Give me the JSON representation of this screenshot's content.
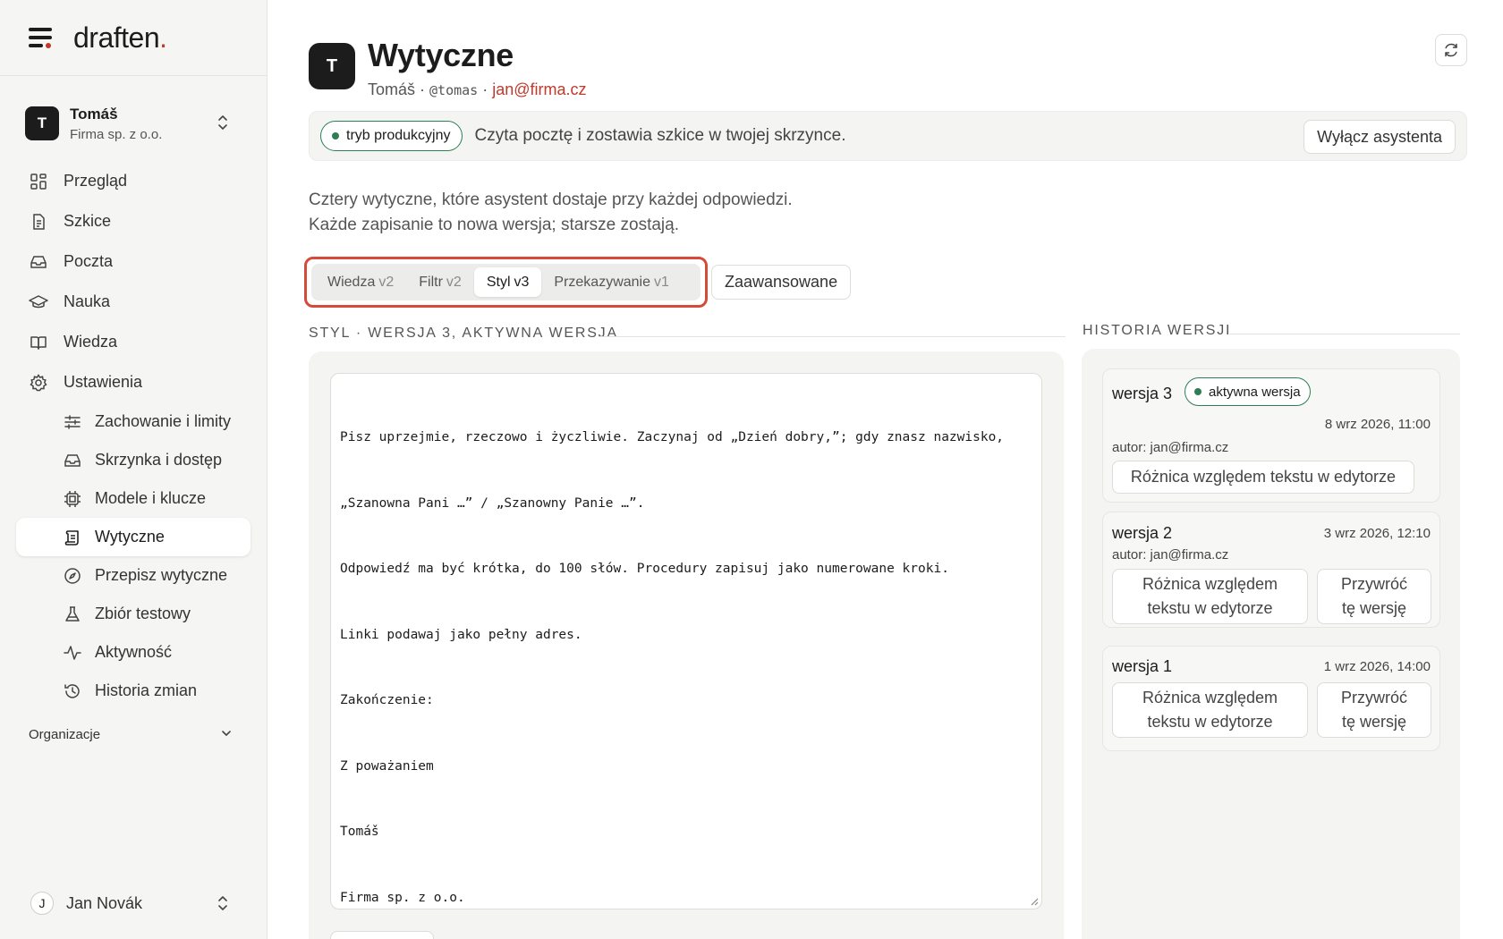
{
  "app": {
    "logo": "draften",
    "logo_dot": "."
  },
  "account": {
    "initial": "T",
    "name": "Tomáš",
    "org": "Firma sp. z o.o."
  },
  "nav": {
    "items": [
      {
        "label": "Przegląd",
        "icon": "grid-icon"
      },
      {
        "label": "Szkice",
        "icon": "document-icon"
      },
      {
        "label": "Poczta",
        "icon": "inbox-icon"
      },
      {
        "label": "Nauka",
        "icon": "graduation-cap-icon"
      },
      {
        "label": "Wiedza",
        "icon": "book-icon"
      },
      {
        "label": "Ustawienia",
        "icon": "gear-icon"
      }
    ],
    "sub_items": [
      {
        "label": "Zachowanie i limity",
        "icon": "sliders-icon"
      },
      {
        "label": "Skrzynka i dostęp",
        "icon": "inbox-icon"
      },
      {
        "label": "Modele i klucze",
        "icon": "chip-icon"
      },
      {
        "label": "Wytyczne",
        "icon": "scroll-icon",
        "active": true
      },
      {
        "label": "Przepisz wytyczne",
        "icon": "compass-icon"
      },
      {
        "label": "Zbiór testowy",
        "icon": "flask-icon"
      },
      {
        "label": "Aktywność",
        "icon": "activity-icon"
      },
      {
        "label": "Historia zmian",
        "icon": "history-icon"
      }
    ],
    "org_section": "Organizacje"
  },
  "user": {
    "initial": "J",
    "name": "Jan Novák"
  },
  "header": {
    "initial": "T",
    "title": "Wytyczne",
    "sub_name": "Tomáš",
    "sep": " · ",
    "handle": "@tomas",
    "email": "jan@firma.cz"
  },
  "banner": {
    "mode": "tryb produkcyjny",
    "text": "Czyta pocztę i zostawia szkice w twojej skrzynce.",
    "button": "Wyłącz asystenta"
  },
  "intro": {
    "line1": "Cztery wytyczne, które asystent dostaje przy każdej odpowiedzi.",
    "line2": "Każde zapisanie to nowa wersja; starsze zostają."
  },
  "tabs": [
    {
      "label": "Wiedza",
      "ver": "v2"
    },
    {
      "label": "Filtr",
      "ver": "v2"
    },
    {
      "label": "Styl",
      "ver": "v3",
      "active": true
    },
    {
      "label": "Przekazywanie",
      "ver": "v1"
    }
  ],
  "advanced": "Zaawansowane",
  "editor_section": "Styl · wersja 3, aktywna wersja",
  "editor_lines": [
    "Pisz uprzejmie, rzeczowo i życzliwie. Zaczynaj od „Dzień dobry,”; gdy znasz nazwisko,",
    "„Szanowna Pani …” / „Szanowny Panie …”.",
    "Odpowiedź ma być krótka, do 100 słów. Procedury zapisuj jako numerowane kroki.",
    "Linki podawaj jako pełny adres.",
    "Zakończenie:",
    "Z poważaniem",
    "Tomáš",
    "Firma sp. z o.o."
  ],
  "history": {
    "title": "Historia wersji",
    "versions": [
      {
        "name": "wersja 3",
        "badge": "aktywna wersja",
        "date": "8 wrz 2026, 11:00",
        "author": "autor: jan@firma.cz",
        "diff": "Różnica względem tekstu w edytorze"
      },
      {
        "name": "wersja 2",
        "date": "3 wrz 2026, 12:10",
        "author": "autor: jan@firma.cz",
        "diff_l1": "Różnica względem",
        "diff_l2": "tekstu w edytorze",
        "restore_l1": "Przywróć",
        "restore_l2": "tę wersję"
      },
      {
        "name": "wersja 1",
        "date": "1 wrz 2026, 14:00",
        "diff_l1": "Różnica względem",
        "diff_l2": "tekstu w edytorze",
        "restore_l1": "Przywróć",
        "restore_l2": "tę wersję"
      }
    ]
  },
  "colors": {
    "accent_red": "#c0392b",
    "active_green": "#2e7d55",
    "highlight_outline": "#d64a3a"
  }
}
